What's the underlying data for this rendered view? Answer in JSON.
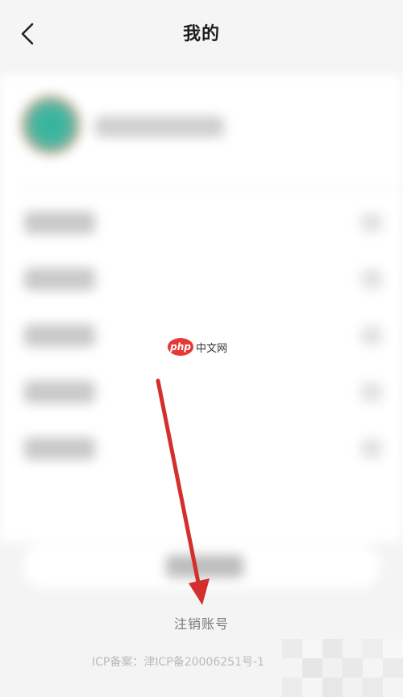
{
  "header": {
    "title": "我的",
    "back_icon": "chevron-left-icon"
  },
  "watermark": {
    "badge": "php",
    "text": "中文网"
  },
  "footer": {
    "cancel_account": "注销账号",
    "icp": "ICP备案：津ICP备20006251号-1"
  },
  "colors": {
    "arrow": "#d32f2f",
    "badge": "#e53935",
    "background": "#f4f4f4"
  }
}
